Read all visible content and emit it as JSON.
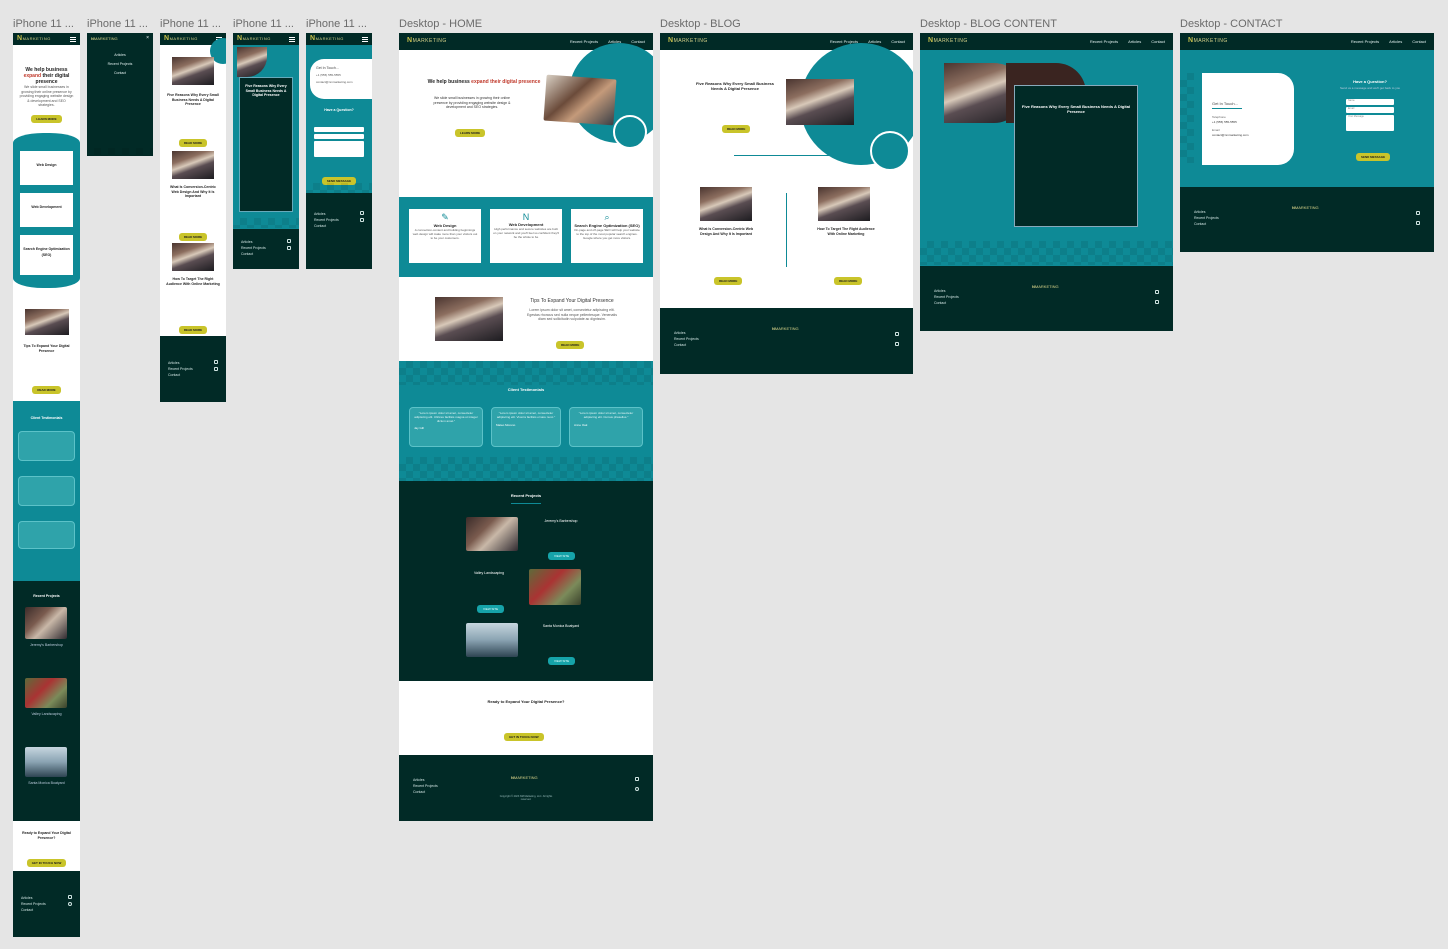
{
  "frame_labels": {
    "m1": "iPhone 11 ...",
    "m2": "iPhone 11 ...",
    "m3": "iPhone 11 ...",
    "m4": "iPhone 11 ...",
    "m5": "iPhone 11 ...",
    "d_home": "Desktop - HOME",
    "d_blog": "Desktop - BLOG",
    "d_blog_content": "Desktop - BLOG CONTENT",
    "d_contact": "Desktop - CONTACT"
  },
  "nav": {
    "logo": "MARKETING",
    "logo_mark": "N",
    "links": [
      "Recent Projects",
      "Articles",
      "Contact"
    ]
  },
  "home": {
    "hero_title_1": "We help business",
    "hero_title_accent": "expand",
    "hero_title_2": "their digital presence",
    "hero_text": "We slide small businesses in growing their online presence by providing engaging website design & development and SEO strategies.",
    "hero_button": "LEARN MORE",
    "services": [
      {
        "icon": "design-icon",
        "title": "Web Design",
        "text": "A connection-content and building beginnings web design will make more than your visitors out to be your customers."
      },
      {
        "icon": "code-icon",
        "title": "Web Development",
        "text": "High performance and secure websites are built on your network and you'll feel so confident they'll be the whole to be"
      },
      {
        "icon": "seo-icon",
        "title": "Search Engine Optimization (SEO)",
        "text": "On-page and off-page SEO will help your website to the top of the most popular search engines. Google where you get more visitors."
      }
    ],
    "tips_title": "Tips To Expand Your Digital Presence",
    "tips_text": "Lorem ipsum dolor sit amet, consectetur adipiscing elit. Egestas rhoncus sed nulla neque pellentesque. Venenatis diam sed sollicitudin vulputate ac dignissim.",
    "tips_button": "READ MORE",
    "testimonials_title": "Client Testimonials",
    "testimonials": [
      {
        "quote": "\"Lorem ipsum dolor sit amet, consectetur adipiscing elit. Ultrices facilisis magna ut integer dictum amet.\"",
        "name": "Jay Gill"
      },
      {
        "quote": "\"Lorem ipsum dolor sit amet, consectetur adipiscing elit. Viverra facilisis ornare nunc.\"",
        "name": "Mateo Moreno"
      },
      {
        "quote": "\"Lorem ipsum dolor sit amet, consectetur adipiscing elit. Cursus phasellus.\"",
        "name": "Anne Oak"
      }
    ],
    "projects_title": "Recent Projects",
    "projects": [
      {
        "title": "Jeremy's Barbershop",
        "button": "VIEW SITE"
      },
      {
        "title": "Valley Landscaping",
        "button": "VIEW SITE"
      },
      {
        "title": "Santa Monica Boatyard",
        "button": "VIEW SITE"
      }
    ],
    "cta_title": "Ready to Expand Your Digital Presence?",
    "cta_button": "GET IN TOUCH NOW"
  },
  "blog": {
    "featured_title": "Five Reasons Why Every Small Business Needs A Digital Presence",
    "featured_button": "READ MORE",
    "posts": [
      {
        "title": "What Is Conversion-Centric Web Design And Why It Is Important",
        "button": "READ MORE"
      },
      {
        "title": "How To Target The Right Audience With Online Marketing",
        "button": "READ MORE"
      }
    ]
  },
  "blog_content": {
    "title": "Five Reasons Why Every Small Business Needs A Digital Presence"
  },
  "contact": {
    "get_in_touch": "Get In Touch...",
    "phone_label": "Telephone",
    "phone": "+1 (555) 555-5555",
    "email_label": "Email",
    "email": "contact@nmmarketing.com",
    "form_title": "Have a Question?",
    "form_subtitle": "Send us a message and we'll get back to you",
    "name_placeholder": "Name",
    "email_placeholder": "Email",
    "message_placeholder": "Your Message",
    "send_button": "SEND MESSAGE"
  },
  "mobile": {
    "menu_items": [
      "Articles",
      "Recent Projects",
      "Contact"
    ],
    "service_titles": [
      "Web Design",
      "Web Development",
      "Search Engine Optimization (SEO)"
    ],
    "blog_titles": [
      "Five Reasons Why Every Small Business Needs A Digital Presence",
      "What Is Conversion-Centric Web Design And Why It Is Important",
      "How To Target The Right Audience With Online Marketing"
    ],
    "project_titles": [
      "Jeremy's Barbershop",
      "Valley Landscaping",
      "Santa Monica Boatyard"
    ]
  },
  "footer": {
    "links": [
      "Articles",
      "Recent Projects",
      "Contact"
    ],
    "copyright": "Copyright © 2023 NM Marketing, LLC. All rights reserved."
  },
  "colors": {
    "dark": "#012a26",
    "teal": "#0e8a96",
    "accent": "#c9c42a",
    "highlight": "#c0392b"
  }
}
